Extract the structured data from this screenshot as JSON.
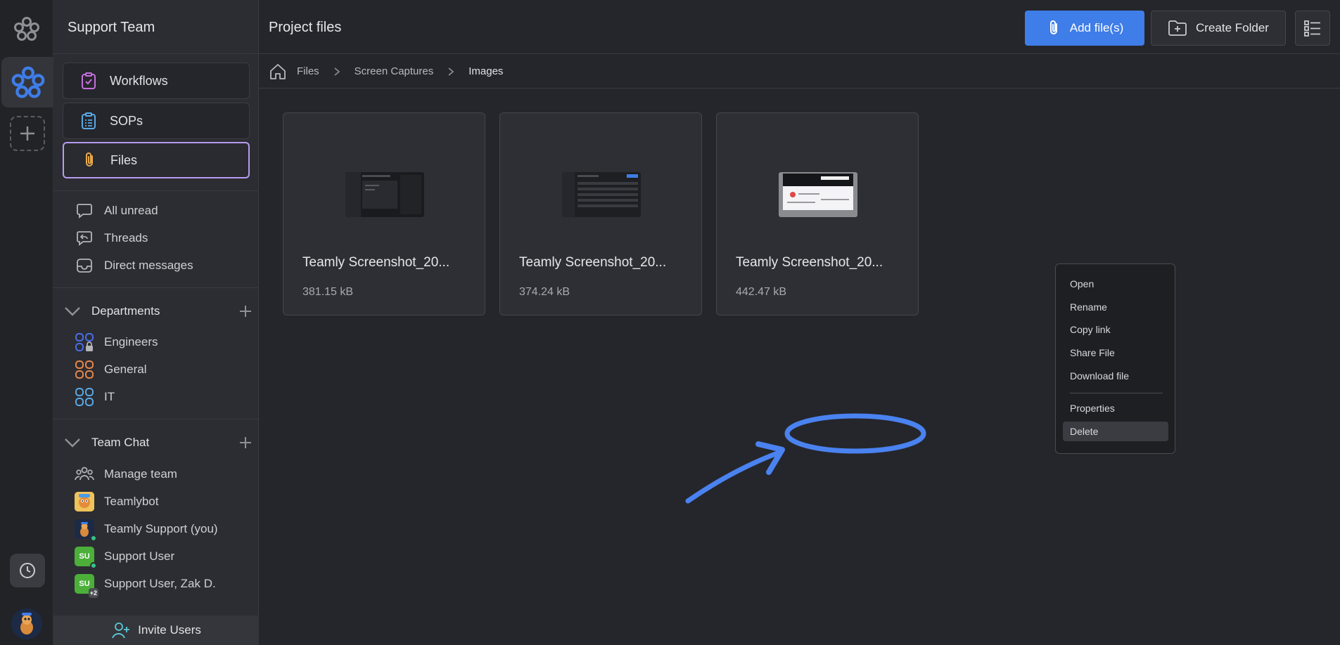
{
  "sidebar": {
    "team_name": "Support Team",
    "nav": [
      {
        "label": "Workflows",
        "icon": "clipboard-check-icon"
      },
      {
        "label": "SOPs",
        "icon": "clipboard-list-icon"
      },
      {
        "label": "Files",
        "icon": "paperclip-icon",
        "active": true
      }
    ],
    "inbox": [
      {
        "label": "All unread",
        "icon": "chat-bubble-icon"
      },
      {
        "label": "Threads",
        "icon": "thread-reply-icon"
      },
      {
        "label": "Direct messages",
        "icon": "inbox-tray-icon"
      }
    ],
    "departments": {
      "label": "Departments",
      "items": [
        {
          "label": "Engineers",
          "color": "#4a6ee8"
        },
        {
          "label": "General",
          "color": "#e8874a"
        },
        {
          "label": "IT",
          "color": "#5aa9e6"
        }
      ]
    },
    "team_chat": {
      "label": "Team Chat",
      "items": [
        {
          "label": "Manage team",
          "icon": "team-group-icon"
        },
        {
          "label": "Teamlybot"
        },
        {
          "label": "Teamly Support (you)"
        },
        {
          "label": "Support User",
          "initials": "SU"
        },
        {
          "label": "Support User, Zak D.",
          "initials": "SU",
          "extra": "+2"
        }
      ]
    },
    "invite_label": "Invite Users"
  },
  "header": {
    "title": "Project files",
    "add_files_label": "Add file(s)",
    "create_folder_label": "Create Folder"
  },
  "breadcrumb": [
    "Files",
    "Screen Captures",
    "Images"
  ],
  "files": [
    {
      "name": "Teamly Screenshot_20...",
      "size": "381.15 kB"
    },
    {
      "name": "Teamly Screenshot_20...",
      "size": "374.24 kB"
    },
    {
      "name": "Teamly Screenshot_20...",
      "size": "442.47 kB"
    }
  ],
  "context_menu": {
    "items": [
      "Open",
      "Rename",
      "Copy link",
      "Share File",
      "Download file"
    ],
    "properties": "Properties",
    "delete": "Delete"
  },
  "colors": {
    "accent": "#3f7de8",
    "active_border": "#b79cf0",
    "annotation": "#4a82f0"
  }
}
